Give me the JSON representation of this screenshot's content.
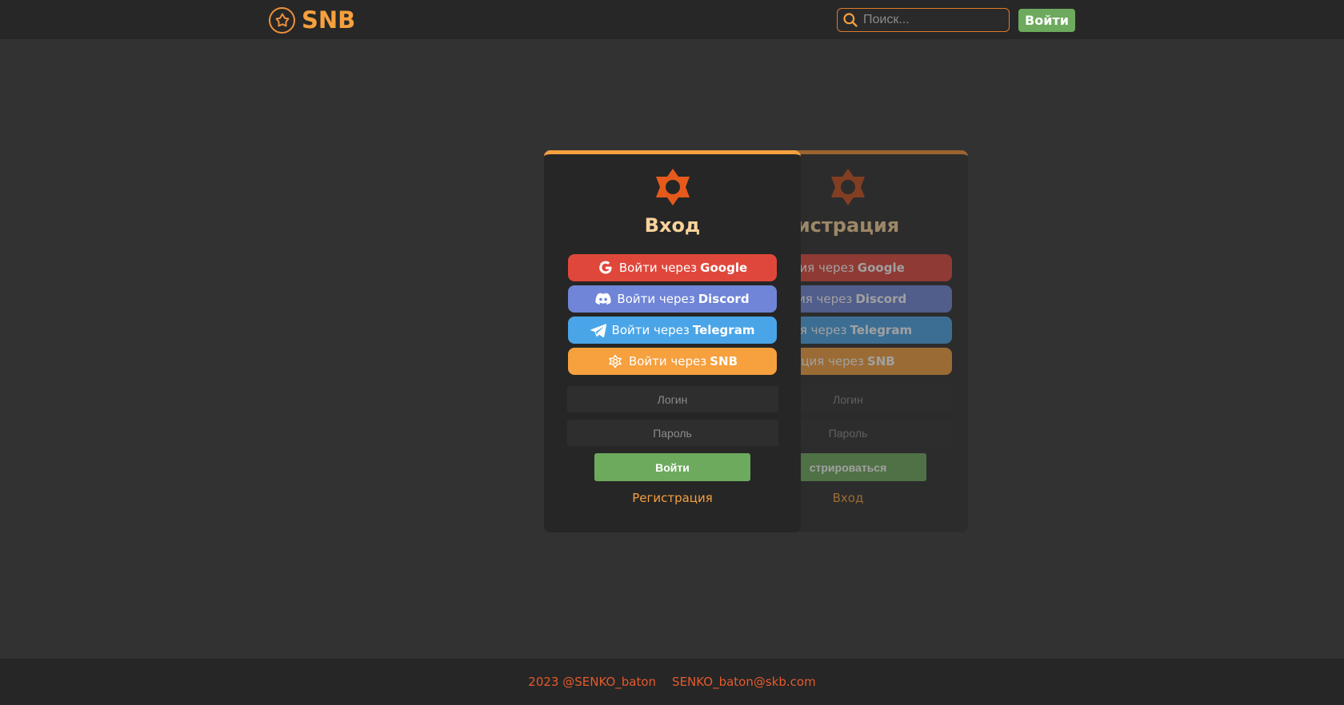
{
  "header": {
    "logo_text": "SNB",
    "search_placeholder": "Поиск...",
    "login_button": "Войти"
  },
  "login_card": {
    "title": "Вход",
    "oauth": [
      {
        "prefix": "Войти через",
        "provider": "Google",
        "icon": "google-icon",
        "color": "#e0473b"
      },
      {
        "prefix": "Войти через",
        "provider": "Discord",
        "icon": "discord-icon",
        "color": "#7085d7"
      },
      {
        "prefix": "Войти через",
        "provider": "Telegram",
        "icon": "telegram-icon",
        "color": "#4aa5e8"
      },
      {
        "prefix": "Войти через",
        "provider": "SNB",
        "icon": "snb-icon",
        "color": "#f6a03e"
      }
    ],
    "login_placeholder": "Логин",
    "password_placeholder": "Пароль",
    "submit_label": "Войти",
    "switch_label": "Регистрация"
  },
  "register_card": {
    "title": "истрация",
    "oauth": [
      {
        "prefix": "ция через",
        "provider": "Google"
      },
      {
        "prefix": "ция через",
        "provider": "Discord"
      },
      {
        "prefix": "ция через",
        "provider": "Telegram"
      },
      {
        "prefix": "ция через",
        "provider": "SNB"
      }
    ],
    "login_placeholder": "Логин",
    "password_placeholder": "Пароль",
    "submit_label": "стрироваться",
    "switch_label": "Вход"
  },
  "footer": {
    "copyright": "2023 @SENKO_baton",
    "email": "SENKO_baton@skb.com"
  },
  "colors": {
    "accent": "#f6a03e",
    "success": "#6daa5d",
    "footer_text": "#e55a2b"
  }
}
